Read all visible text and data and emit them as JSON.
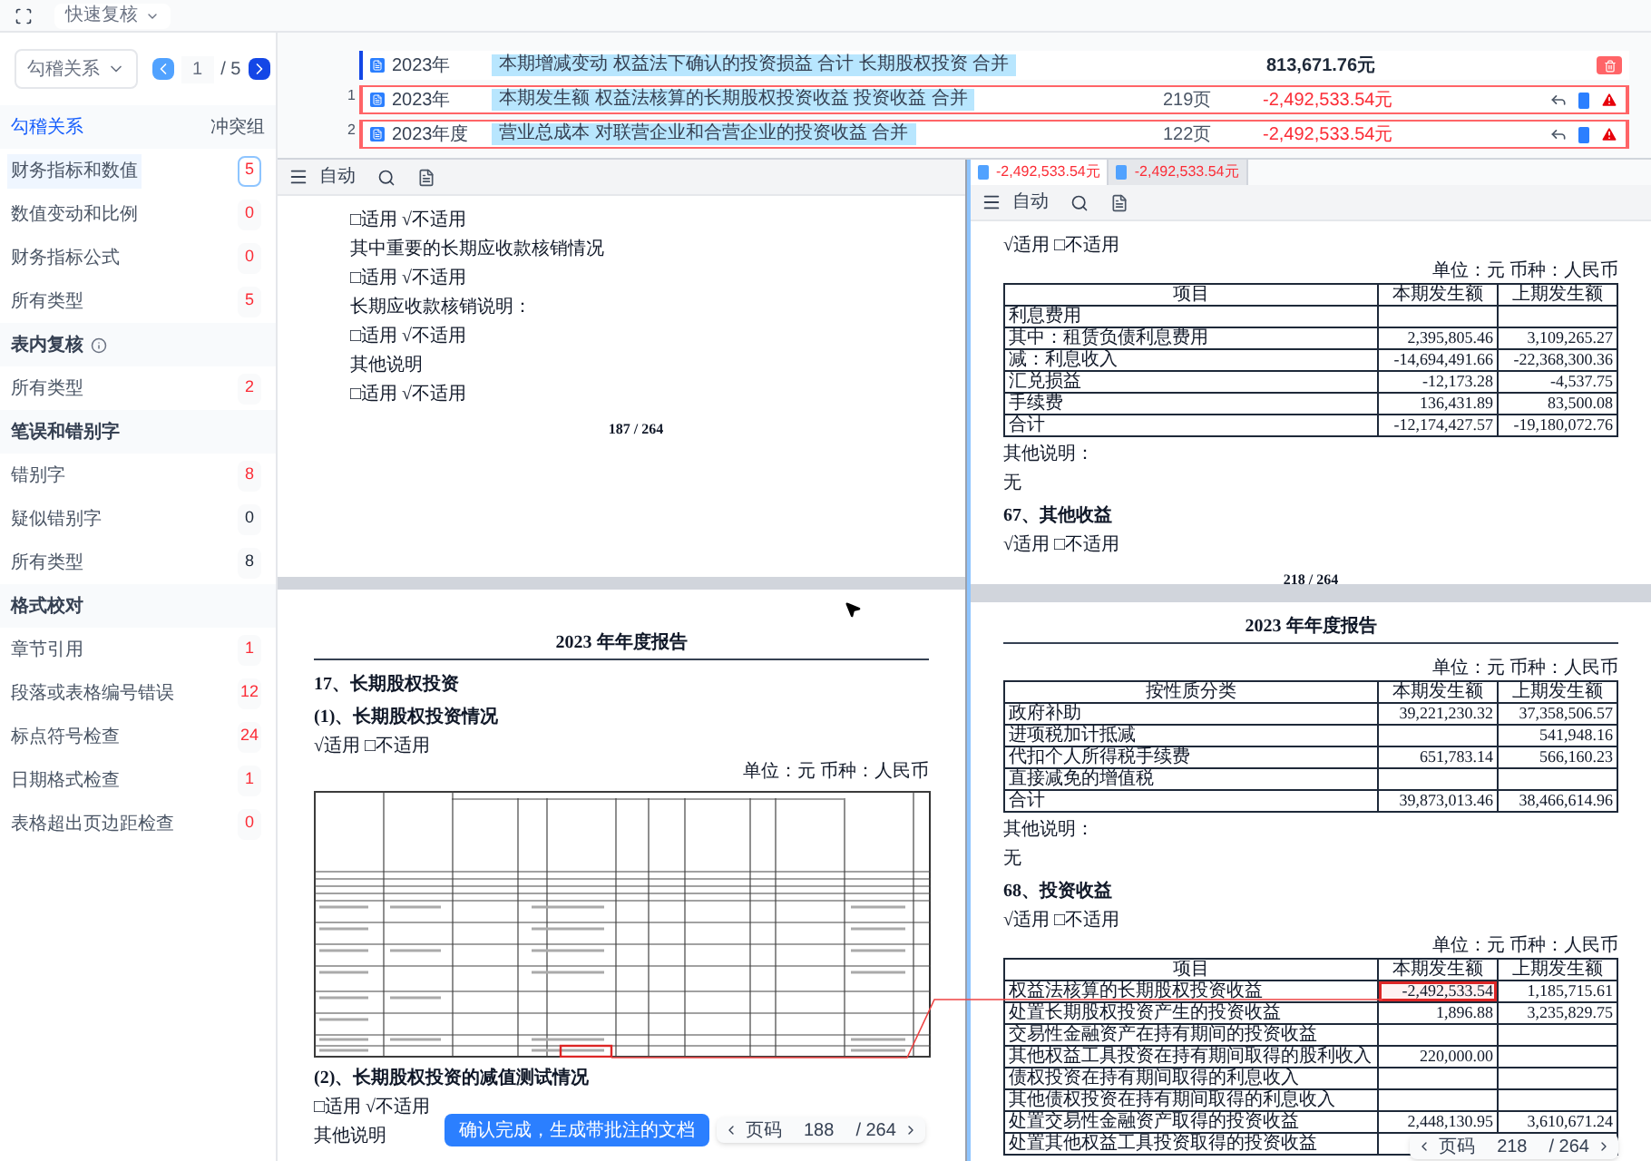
{
  "toolbar": {
    "mode_dropdown": "快速复核"
  },
  "sidebar": {
    "pager": {
      "dropdown": "勾稽关系",
      "page": "1",
      "total": "/ 5"
    },
    "groups": [
      {
        "title": "勾稽关系",
        "note": "冲突组",
        "active": true,
        "info": false,
        "items": [
          {
            "label": "财务指标和数值",
            "count": "5",
            "flagged": true,
            "selected": true
          },
          {
            "label": "数值变动和比例",
            "count": "0",
            "flagged": true,
            "selected": false
          },
          {
            "label": "财务指标公式",
            "count": "0",
            "flagged": true,
            "selected": false
          },
          {
            "label": "所有类型",
            "count": "5",
            "flagged": true,
            "selected": false
          }
        ]
      },
      {
        "title": "表内复核",
        "active": false,
        "info": true,
        "items": [
          {
            "label": "所有类型",
            "count": "2",
            "flagged": true,
            "selected": false
          }
        ]
      },
      {
        "title": "笔误和错别字",
        "active": false,
        "info": false,
        "items": [
          {
            "label": "错别字",
            "count": "8",
            "flagged": true,
            "selected": false
          },
          {
            "label": "疑似错别字",
            "count": "0",
            "flagged": false,
            "selected": false
          },
          {
            "label": "所有类型",
            "count": "8",
            "flagged": false,
            "selected": false
          }
        ]
      },
      {
        "title": "格式校对",
        "active": false,
        "info": false,
        "items": [
          {
            "label": "章节引用",
            "count": "1",
            "flagged": true,
            "selected": false
          },
          {
            "label": "段落或表格编号错误",
            "count": "12",
            "flagged": true,
            "selected": false
          },
          {
            "label": "标点符号检查",
            "count": "24",
            "flagged": true,
            "selected": false
          },
          {
            "label": "日期格式检查",
            "count": "1",
            "flagged": true,
            "selected": false
          },
          {
            "label": "表格超出页边距检查",
            "count": "0",
            "flagged": true,
            "selected": false
          }
        ]
      }
    ]
  },
  "issues": [
    {
      "kind": "source",
      "year": "2023年",
      "tag": "本期增减变动 权益法下确认的投资损益 合计 长期股权投资 合并",
      "amount": "813,671.76元"
    },
    {
      "kind": "conflict",
      "index": "1",
      "year": "2023年",
      "tag": "本期发生额 权益法核算的长期股权投资收益 投资收益 合并",
      "page": "219页",
      "amount": "-2,492,533.54元"
    },
    {
      "kind": "conflict",
      "index": "2",
      "year": "2023年度",
      "tag": "营业总成本 对联营企业和合营企业的投资收益 合并",
      "page": "122页",
      "amount": "-2,492,533.54元"
    }
  ],
  "left_viewer": {
    "zoom": "自动",
    "pages": [
      {
        "blocks": [
          {
            "kind": "check",
            "text": "□适用 √不适用"
          },
          {
            "kind": "text",
            "text": "其中重要的长期应收款核销情况"
          },
          {
            "kind": "check",
            "text": "□适用 √不适用"
          },
          {
            "kind": "text",
            "text": "长期应收款核销说明："
          },
          {
            "kind": "check",
            "text": "□适用  √不适用"
          },
          {
            "kind": "text",
            "text": "其他说明"
          },
          {
            "kind": "check",
            "text": "□适用 √不适用"
          },
          {
            "kind": "footer",
            "text": "187 / 264"
          }
        ]
      },
      {
        "blocks": [
          {
            "kind": "header",
            "text": "2023 年年度报告"
          },
          {
            "kind": "heading",
            "text": "17、长期股权投资"
          },
          {
            "kind": "heading",
            "text": "(1)、长期股权投资情况"
          },
          {
            "kind": "check",
            "text": "√适用 □不适用"
          },
          {
            "kind": "unit",
            "text": "单位：元  币种：人民币"
          },
          {
            "kind": "table_drawing"
          },
          {
            "kind": "heading",
            "text": "(2)、长期股权投资的减值测试情况"
          },
          {
            "kind": "check",
            "text": "□适用 √不适用"
          },
          {
            "kind": "text",
            "text": "其他说明"
          }
        ]
      }
    ],
    "confirm_button": "确认完成，生成带批注的文档",
    "pager": {
      "label": "页码",
      "page": "188",
      "total": "/ 264"
    }
  },
  "right_viewer": {
    "tabs": [
      {
        "label": "-2,492,533.54元",
        "selected": true
      },
      {
        "label": "-2,492,533.54元",
        "selected": false
      }
    ],
    "zoom": "自动",
    "pages": [
      {
        "blocks": [
          {
            "kind": "check",
            "text": "√适用 □不适用"
          },
          {
            "kind": "unit",
            "text": "单位：元  币种：人民币"
          },
          {
            "kind": "table",
            "columns": [
              "项目",
              "本期发生额",
              "上期发生额"
            ],
            "rows": [
              {
                "cells": [
                  "利息费用",
                  "",
                  ""
                ],
                "highlighted": false
              },
              {
                "cells": [
                  "其中：租赁负债利息费用",
                  "2,395,805.46",
                  "3,109,265.27"
                ],
                "highlighted": false
              },
              {
                "cells": [
                  "减：利息收入",
                  "-14,694,491.66",
                  "-22,368,300.36"
                ],
                "highlighted": false
              },
              {
                "cells": [
                  "汇兑损益",
                  "-12,173.28",
                  "-4,537.75"
                ],
                "highlighted": false
              },
              {
                "cells": [
                  "手续费",
                  "136,431.89",
                  "83,500.08"
                ],
                "highlighted": false
              },
              {
                "cells": [
                  "合计",
                  "-12,174,427.57",
                  "-19,180,072.76"
                ],
                "highlighted": false
              }
            ]
          },
          {
            "kind": "text",
            "text": "其他说明："
          },
          {
            "kind": "text",
            "text": "无"
          },
          {
            "kind": "heading",
            "text": "67、其他收益"
          },
          {
            "kind": "check",
            "text": "√适用 □不适用"
          },
          {
            "kind": "footer",
            "text": "218 / 264"
          }
        ]
      },
      {
        "blocks": [
          {
            "kind": "header",
            "text": "2023 年年度报告"
          },
          {
            "kind": "unit",
            "text": "单位：元  币种：人民币"
          },
          {
            "kind": "table",
            "columns": [
              "按性质分类",
              "本期发生额",
              "上期发生额"
            ],
            "rows": [
              {
                "cells": [
                  "政府补助",
                  "39,221,230.32",
                  "37,358,506.57"
                ],
                "highlighted": false
              },
              {
                "cells": [
                  "进项税加计抵减",
                  "",
                  "541,948.16"
                ],
                "highlighted": false
              },
              {
                "cells": [
                  "代扣个人所得税手续费",
                  "651,783.14",
                  "566,160.23"
                ],
                "highlighted": false
              },
              {
                "cells": [
                  "直接减免的增值税",
                  "",
                  ""
                ],
                "highlighted": false
              },
              {
                "cells": [
                  "合计",
                  "39,873,013.46",
                  "38,466,614.96"
                ],
                "highlighted": false
              }
            ]
          },
          {
            "kind": "text",
            "text": "其他说明："
          },
          {
            "kind": "text",
            "text": "无"
          },
          {
            "kind": "heading",
            "text": "68、投资收益"
          },
          {
            "kind": "check",
            "text": "√适用 □不适用"
          },
          {
            "kind": "unit",
            "text": "单位：元  币种：人民币"
          },
          {
            "kind": "table",
            "columns": [
              "项目",
              "本期发生额",
              "上期发生额"
            ],
            "rows": [
              {
                "cells": [
                  "权益法核算的长期股权投资收益",
                  "-2,492,533.54",
                  "1,185,715.61"
                ],
                "highlighted": true
              },
              {
                "cells": [
                  "处置长期股权投资产生的投资收益",
                  "1,896.88",
                  "3,235,829.75"
                ],
                "highlighted": false
              },
              {
                "cells": [
                  "交易性金融资产在持有期间的投资收益",
                  "",
                  ""
                ],
                "highlighted": false
              },
              {
                "cells": [
                  "其他权益工具投资在持有期间取得的股利收入",
                  "220,000.00",
                  ""
                ],
                "highlighted": false
              },
              {
                "cells": [
                  "债权投资在持有期间取得的利息收入",
                  "",
                  ""
                ],
                "highlighted": false
              },
              {
                "cells": [
                  "其他债权投资在持有期间取得的利息收入",
                  "",
                  ""
                ],
                "highlighted": false
              },
              {
                "cells": [
                  "处置交易性金融资产取得的投资收益",
                  "2,448,130.95",
                  "3,610,671.24"
                ],
                "highlighted": false
              },
              {
                "cells": [
                  "处置其他权益工具投资取得的投资收益",
                  "",
                  ""
                ],
                "highlighted": false
              }
            ]
          }
        ]
      }
    ],
    "pager": {
      "label": "页码",
      "page": "218",
      "total": "/ 264"
    }
  }
}
